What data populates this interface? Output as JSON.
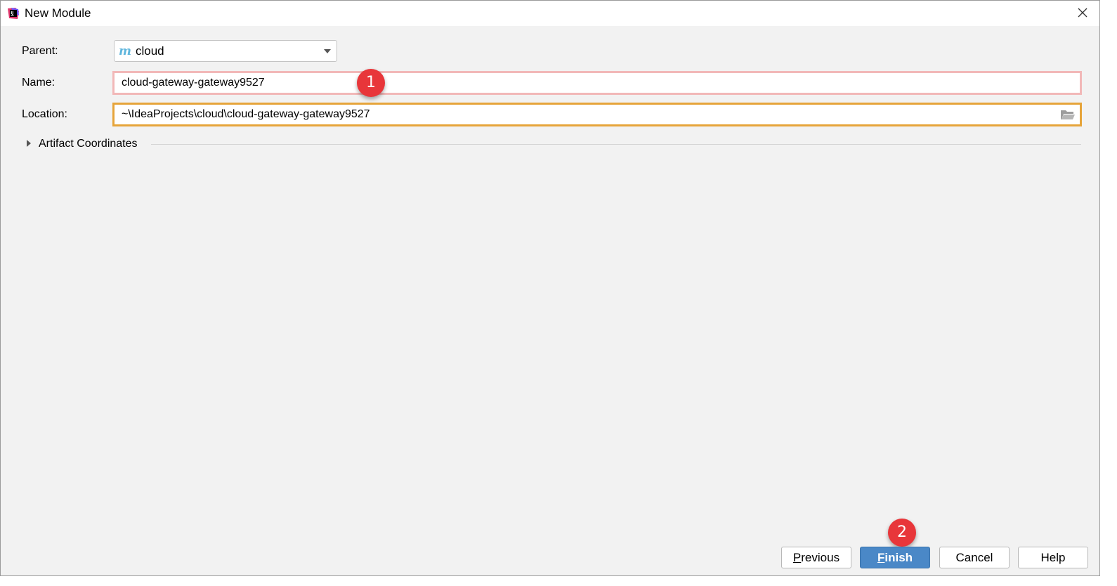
{
  "window": {
    "title": "New Module"
  },
  "form": {
    "parent_label": "Parent:",
    "parent_value": "cloud",
    "parent_icon": "maven-m-icon",
    "name_label": "Name:",
    "name_value": "cloud-gateway-gateway9527",
    "location_label": "Location:",
    "location_value": "~\\IdeaProjects\\cloud\\cloud-gateway-gateway9527",
    "location_icon": "folder-icon"
  },
  "artifact": {
    "label": "Artifact Coordinates",
    "expanded": false
  },
  "annotations": {
    "step1": "1",
    "step2": "2",
    "color": "#e8363a"
  },
  "buttons": {
    "previous_mnemonic": "P",
    "previous_rest": "revious",
    "finish_mnemonic": "F",
    "finish_rest": "inish",
    "cancel": "Cancel",
    "help": "Help"
  },
  "colors": {
    "primary_button": "#4a88c7",
    "name_field_border": "#f2b8b8",
    "location_field_border": "#e6a43a",
    "maven_icon": "#5fb6dd"
  }
}
